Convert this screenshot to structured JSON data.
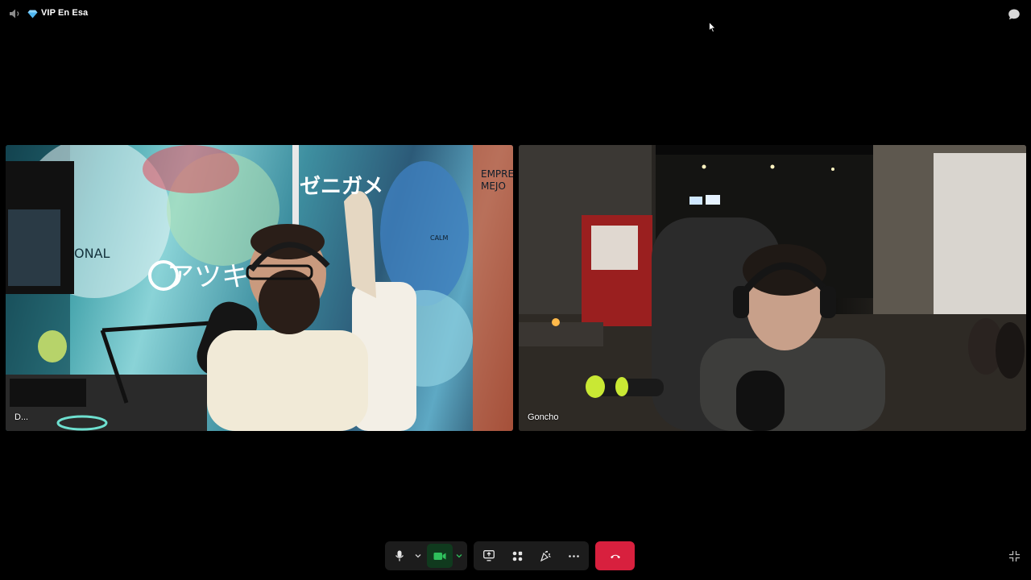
{
  "topbar": {
    "room_title": "VIP En Esa",
    "icons": [
      "speaker-muted-icon",
      "gem-icon",
      "chat-icon"
    ]
  },
  "participants": [
    {
      "name": "D...",
      "overlay_text": [
        "ゼニガメ",
        "アツキ",
        "ONAL",
        "EMPRE",
        "MEJO",
        "CALM"
      ]
    },
    {
      "name": "Goncho"
    }
  ],
  "controls": {
    "icons": [
      "microphone-icon",
      "chevron-down-icon",
      "camera-icon",
      "chevron-down-icon",
      "share-screen-icon",
      "apps-icon",
      "reactions-icon",
      "more-icon",
      "end-call-icon",
      "collapse-icon"
    ],
    "colors": {
      "camera_active": "#2fbf5c",
      "end_call": "#d8203e",
      "group_bg": "#1c1c1c"
    }
  }
}
